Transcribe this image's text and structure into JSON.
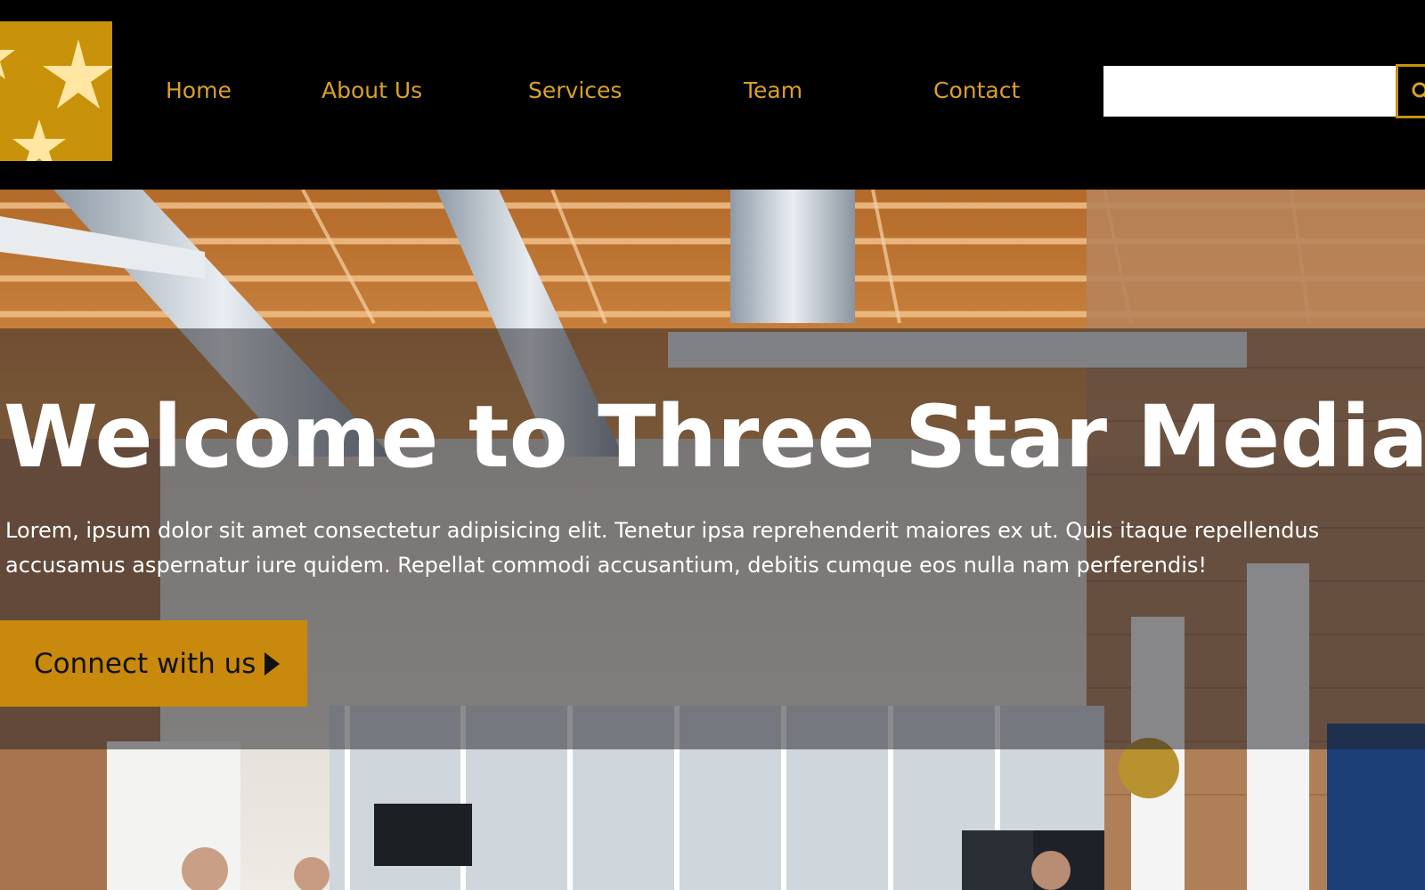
{
  "brand": {
    "logo_icon": "three-stars-logo",
    "accent_color": "#c8920a",
    "nav_text_color": "#d9a02a"
  },
  "nav": {
    "items": [
      {
        "label": "Home"
      },
      {
        "label": "About Us"
      },
      {
        "label": "Services"
      },
      {
        "label": "Team"
      },
      {
        "label": "Contact"
      }
    ]
  },
  "search": {
    "value": "",
    "button_icon": "search-icon"
  },
  "hero": {
    "title": "Welcome to Three Star Media",
    "text": "Lorem, ipsum dolor sit amet consectetur adipisicing elit. Tenetur ipsa reprehenderit maiores ex ut. Quis itaque repellendus accusamus aspernatur iure quidem. Repellat commodi accusantium, debitis cumque eos nulla nam perferendis!",
    "cta_label": "Connect with us",
    "cta_icon": "caret-right-icon",
    "cta_color": "#c8890c",
    "background": "office-interior-photo"
  }
}
